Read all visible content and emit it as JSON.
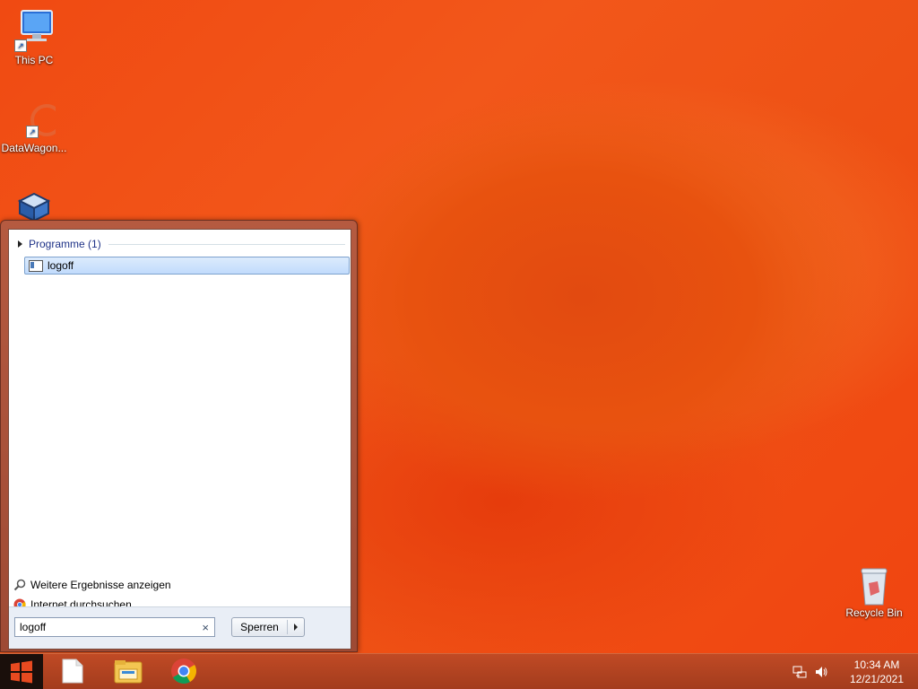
{
  "desktop": {
    "icons": [
      {
        "label": "This PC"
      },
      {
        "label": "DataWagon..."
      },
      {
        "label": ""
      },
      {
        "label": "Recycle Bin"
      }
    ]
  },
  "start_menu": {
    "group_header": "Programme (1)",
    "results": [
      {
        "label": "logoff",
        "icon": "console-app-icon"
      }
    ],
    "links": [
      {
        "label": "Weitere Ergebnisse anzeigen",
        "icon": "search-icon"
      },
      {
        "label": "Internet durchsuchen",
        "icon": "chrome-icon"
      }
    ],
    "search": {
      "value": "logoff",
      "clear_icon": "×"
    },
    "power_button": {
      "label": "Sperren"
    }
  },
  "taskbar": {
    "pinned": [
      "file-icon",
      "file-explorer-icon",
      "chrome-icon"
    ],
    "tray": {
      "time": "10:34 AM",
      "date": "12/21/2021"
    }
  }
}
